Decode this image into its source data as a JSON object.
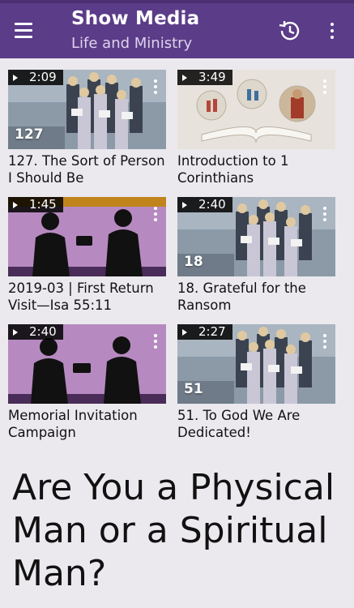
{
  "appbar": {
    "title": "Show Media",
    "subtitle": "Life and Ministry",
    "menu_icon": "hamburger-menu-icon",
    "history_icon": "history-icon",
    "more_icon": "more-vertical-icon",
    "background": "#5b3c88"
  },
  "videos": [
    {
      "duration": "2:09",
      "number": "127",
      "title": "127. The Sort of Person I Should Be",
      "thumb": "choir"
    },
    {
      "duration": "3:49",
      "number": "",
      "title": "Introduction to 1 Corinthians",
      "thumb": "bible"
    },
    {
      "duration": "1:45",
      "number": "",
      "title": "2019-03 | First Return Visit—Isa 55:11",
      "thumb": "silhouette-orange"
    },
    {
      "duration": "2:40",
      "number": "18",
      "title": "18. Grateful for the Ransom",
      "thumb": "choir"
    },
    {
      "duration": "2:40",
      "number": "",
      "title": "Memorial Invitation Campaign",
      "thumb": "silhouette-purple"
    },
    {
      "duration": "2:27",
      "number": "51",
      "title": "51. To God We Are Dedicated!",
      "thumb": "choir"
    }
  ],
  "heading": "Are You a Physical Man or a Spiritual Man?"
}
